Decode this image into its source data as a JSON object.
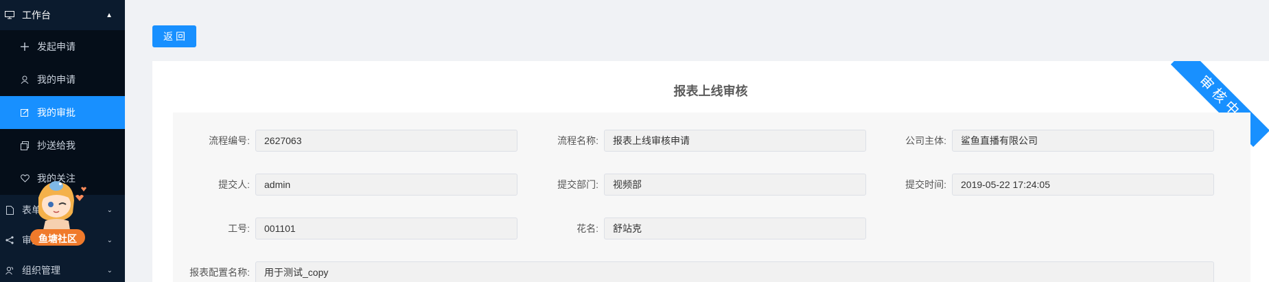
{
  "sidebar": {
    "workbench_label": "工作台",
    "items": [
      {
        "label": "发起申请"
      },
      {
        "label": "我的申请"
      },
      {
        "label": "我的审批"
      },
      {
        "label": "抄送给我"
      },
      {
        "label": "我的关注"
      }
    ],
    "groups": [
      {
        "label": "表单"
      },
      {
        "label": "审批"
      },
      {
        "label": "组织管理"
      }
    ],
    "active_color": "#1890ff",
    "bg_color": "#0b1b2e"
  },
  "mascot": {
    "badge_text": "鱼塘社区"
  },
  "toolbar": {
    "back_label": "返回"
  },
  "card": {
    "title": "报表上线审核",
    "status_ribbon": "审核中"
  },
  "form": {
    "flow_no_label": "流程编号:",
    "flow_no_value": "2627063",
    "flow_name_label": "流程名称:",
    "flow_name_value": "报表上线审核申请",
    "company_label": "公司主体:",
    "company_value": "鲨鱼直播有限公司",
    "submitter_label": "提交人:",
    "submitter_value": "admin",
    "dept_label": "提交部门:",
    "dept_value": "视频部",
    "time_label": "提交时间:",
    "time_value": "2019-05-22 17:24:05",
    "emp_no_label": "工号:",
    "emp_no_value": "001101",
    "nickname_label": "花名:",
    "nickname_value": "舒站克",
    "report_name_label": "报表配置名称:",
    "report_name_value": "用于测试_copy"
  }
}
